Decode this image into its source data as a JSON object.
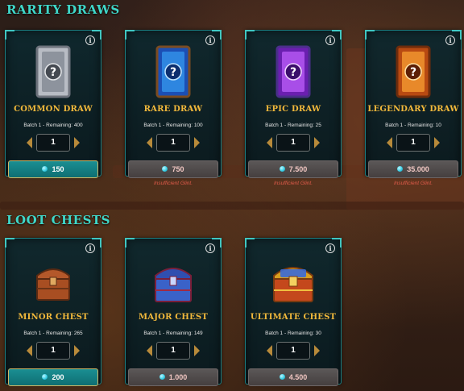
{
  "sections": {
    "rarity_title": "RARITY DRAWS",
    "loot_title": "LOOT CHESTS"
  },
  "rarity_cards": [
    {
      "title": "COMMON DRAW",
      "remaining": "Batch 1 - Remaining: 400",
      "quantity": "1",
      "price": "150",
      "affordable": true,
      "warning": ""
    },
    {
      "title": "RARE DRAW",
      "remaining": "Batch 1 - Remaining: 100",
      "quantity": "1",
      "price": "750",
      "affordable": false,
      "warning": "Insufficient Glint."
    },
    {
      "title": "EPIC DRAW",
      "remaining": "Batch 1 - Remaining: 25",
      "quantity": "1",
      "price": "7.500",
      "affordable": false,
      "warning": "Insufficient Glint."
    },
    {
      "title": "LEGENDARY DRAW",
      "remaining": "Batch 1 - Remaining: 10",
      "quantity": "1",
      "price": "35.000",
      "affordable": false,
      "warning": "Insufficient Glint."
    }
  ],
  "chest_cards": [
    {
      "title": "MINOR CHEST",
      "remaining": "Batch 1 - Remaining: 265",
      "quantity": "1",
      "price": "200",
      "affordable": true
    },
    {
      "title": "MAJOR CHEST",
      "remaining": "Batch 1 - Remaining: 149",
      "quantity": "1",
      "price": "1.000",
      "affordable": false
    },
    {
      "title": "ULTIMATE CHEST",
      "remaining": "Batch 1 - Remaining: 30",
      "quantity": "1",
      "price": "4.500",
      "affordable": false
    }
  ],
  "icons": {
    "info": "i",
    "currency": "glint-gem-icon"
  },
  "colors": {
    "accent": "#3fd7c9",
    "title_gold": "#f1b83b",
    "warning": "#e15b4b"
  }
}
